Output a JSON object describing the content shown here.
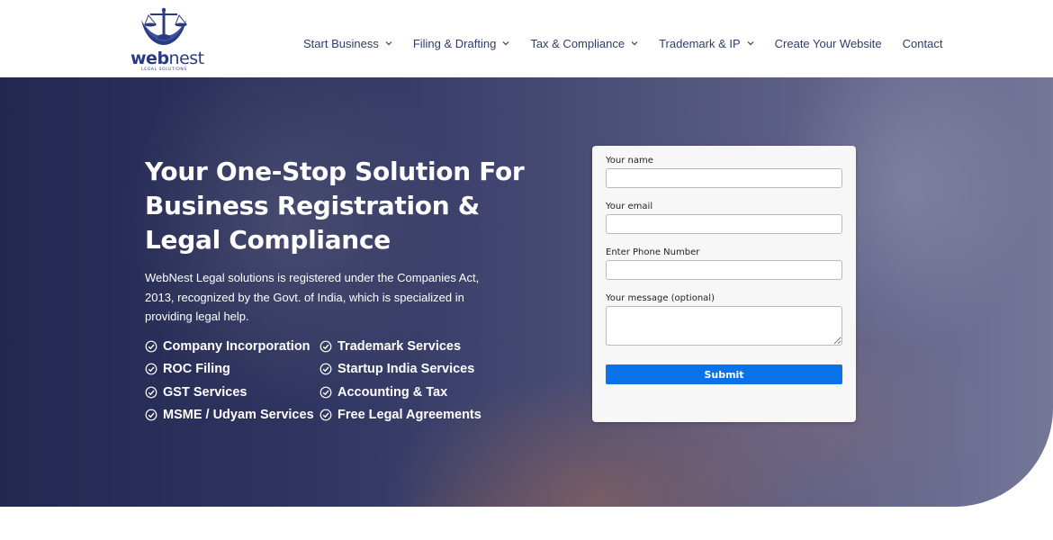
{
  "brand": {
    "logo_word_bold": "web",
    "logo_word_light": "nest",
    "logo_sub": "LEGAL SOLUTIONS",
    "icon": "scales-of-justice-icon",
    "color": "#2b3a85"
  },
  "nav": {
    "items": [
      {
        "label": "Start Business",
        "has_dropdown": true
      },
      {
        "label": "Filing & Drafting",
        "has_dropdown": true
      },
      {
        "label": "Tax & Compliance",
        "has_dropdown": true
      },
      {
        "label": "Trademark & IP",
        "has_dropdown": true
      },
      {
        "label": "Create Your Website",
        "has_dropdown": false
      },
      {
        "label": "Contact",
        "has_dropdown": false
      }
    ]
  },
  "hero": {
    "title_lines": [
      "Your One-Stop Solution For",
      "Business Registration &",
      "Legal Compliance"
    ],
    "description": "WebNest Legal solutions is registered under the Companies Act, 2013, recognized by the Govt. of India, which is specialized in providing legal help.",
    "features": [
      "Company Incorporation",
      "Trademark Services",
      "ROC Filing",
      "Startup India Services",
      "GST Services",
      "Accounting & Tax",
      "MSME / Udyam Services",
      "Free Legal Agreements"
    ],
    "feature_icon": "check-circle-icon"
  },
  "form": {
    "name_label": "Your name",
    "name_value": "",
    "email_label": "Your email",
    "email_value": "",
    "phone_label": "Enter Phone Number",
    "phone_value": "",
    "message_label": "Your message (optional)",
    "message_value": "",
    "submit_label": "Submit",
    "submit_color": "#0b73ea"
  }
}
